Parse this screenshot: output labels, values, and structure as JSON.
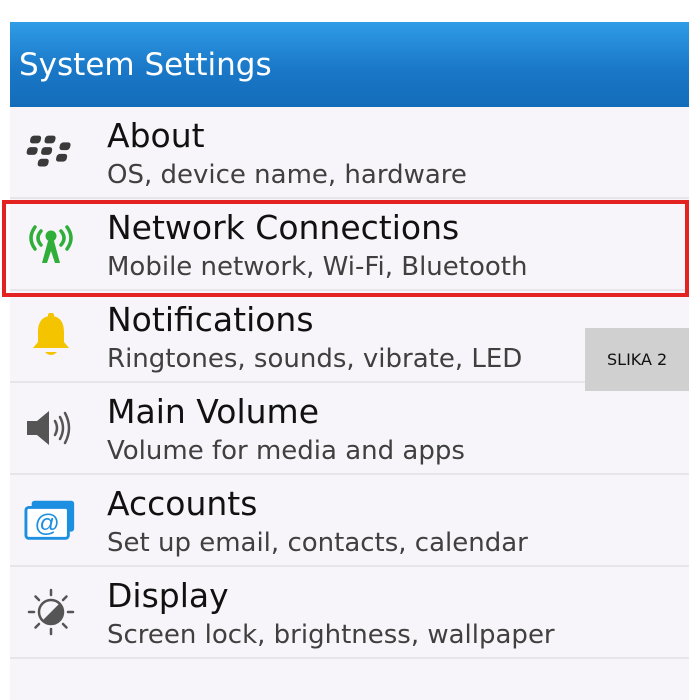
{
  "header": {
    "title": "System Settings"
  },
  "items": [
    {
      "title": "About",
      "subtitle": "OS, device name, hardware",
      "icon": "blackberry-logo-icon"
    },
    {
      "title": "Network Connections",
      "subtitle": "Mobile network, Wi-Fi, Bluetooth",
      "icon": "antenna-icon"
    },
    {
      "title": "Notifications",
      "subtitle": "Ringtones, sounds, vibrate, LED",
      "icon": "bell-icon"
    },
    {
      "title": "Main Volume",
      "subtitle": "Volume for media and apps",
      "icon": "speaker-icon"
    },
    {
      "title": "Accounts",
      "subtitle": "Set up email, contacts, calendar",
      "icon": "at-sign-icon"
    },
    {
      "title": "Display",
      "subtitle": "Screen lock, brightness, wallpaper",
      "icon": "brightness-icon"
    }
  ],
  "overlay": {
    "label": "SLIKA 2"
  },
  "colors": {
    "header": "#1a78c8",
    "highlight": "#e32222",
    "antenna": "#2fae3a",
    "bell": "#f5c400",
    "accounts": "#1d8fe0"
  }
}
